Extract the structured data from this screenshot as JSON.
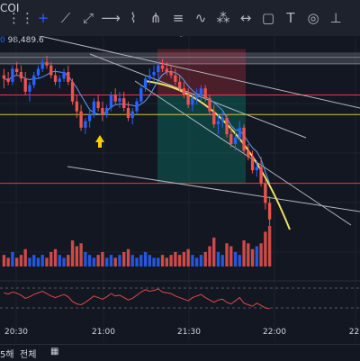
{
  "toolbar": {
    "symbol": "COI",
    "tools": [
      {
        "name": "dots-grid-icon",
        "glyph": "⋮⋮"
      },
      {
        "name": "crosshair-icon",
        "glyph": "+",
        "active": true
      },
      {
        "name": "trend-line-icon",
        "glyph": "⟋"
      },
      {
        "name": "ray-icon",
        "glyph": "⤢"
      },
      {
        "name": "horizontal-ray-icon",
        "glyph": "⟶"
      },
      {
        "name": "path-icon",
        "glyph": "⌇"
      },
      {
        "name": "pitchfork-icon",
        "glyph": "⋔"
      },
      {
        "name": "fib-retracement-icon",
        "glyph": "≡"
      },
      {
        "name": "elliott-wave-icon",
        "glyph": "∿"
      },
      {
        "name": "pattern-icon",
        "glyph": "⁂"
      },
      {
        "name": "measure-icon",
        "glyph": "↔"
      },
      {
        "name": "rectangle-icon",
        "glyph": "▢"
      },
      {
        "name": "text-icon",
        "glyph": "T"
      },
      {
        "name": "note-icon",
        "glyph": "◎"
      },
      {
        "name": "magnet-icon",
        "glyph": "⊥"
      }
    ]
  },
  "legend": {
    "price_suffix": "0",
    "price": "98,489.6"
  },
  "bottom": {
    "interval_suffix": "5해",
    "all_label": "전체",
    "calendar_icon": "calendar-icon"
  },
  "colors": {
    "up": "#2962ff",
    "down": "#ef5350",
    "ma": "#5b9cf0",
    "rsi": "#e04747",
    "accent": "#f0e060",
    "bg": "#131722"
  },
  "chart_data": {
    "type": "candlestick",
    "x_ticks": [
      "20:30",
      "21:00",
      "21:30",
      "22:00",
      "22:"
    ],
    "ohlc": [
      [
        96,
        98,
        92,
        95
      ],
      [
        95,
        97,
        93,
        94
      ],
      [
        94,
        99,
        93,
        98
      ],
      [
        98,
        100,
        96,
        97
      ],
      [
        97,
        99,
        94,
        95
      ],
      [
        95,
        97,
        90,
        91
      ],
      [
        91,
        94,
        88,
        93
      ],
      [
        93,
        97,
        92,
        96
      ],
      [
        96,
        99,
        95,
        98
      ],
      [
        98,
        101,
        97,
        100
      ],
      [
        100,
        102,
        98,
        99
      ],
      [
        99,
        100,
        95,
        96
      ],
      [
        96,
        98,
        93,
        94
      ],
      [
        94,
        96,
        92,
        95
      ],
      [
        95,
        98,
        94,
        97
      ],
      [
        97,
        99,
        93,
        94
      ],
      [
        94,
        95,
        87,
        88
      ],
      [
        88,
        90,
        83,
        85
      ],
      [
        85,
        87,
        79,
        80
      ],
      [
        80,
        83,
        78,
        82
      ],
      [
        82,
        86,
        80,
        84
      ],
      [
        84,
        89,
        83,
        88
      ],
      [
        88,
        90,
        85,
        86
      ],
      [
        86,
        88,
        82,
        84
      ],
      [
        84,
        87,
        83,
        86
      ],
      [
        86,
        91,
        85,
        90
      ],
      [
        90,
        92,
        87,
        88
      ],
      [
        88,
        91,
        86,
        89
      ],
      [
        89,
        91,
        85,
        86
      ],
      [
        86,
        88,
        82,
        83
      ],
      [
        83,
        86,
        81,
        85
      ],
      [
        85,
        89,
        84,
        88
      ],
      [
        88,
        93,
        87,
        92
      ],
      [
        92,
        96,
        91,
        95
      ],
      [
        95,
        98,
        93,
        96
      ],
      [
        96,
        99,
        94,
        97
      ],
      [
        97,
        100,
        95,
        99
      ],
      [
        99,
        101,
        97,
        98
      ],
      [
        98,
        100,
        96,
        97
      ],
      [
        97,
        99,
        95,
        96
      ],
      [
        96,
        98,
        93,
        94
      ],
      [
        94,
        96,
        91,
        92
      ],
      [
        92,
        94,
        89,
        90
      ],
      [
        90,
        92,
        86,
        87
      ],
      [
        87,
        90,
        85,
        89
      ],
      [
        89,
        92,
        87,
        90
      ],
      [
        90,
        93,
        88,
        92
      ],
      [
        92,
        93,
        88,
        89
      ],
      [
        89,
        90,
        84,
        85
      ],
      [
        85,
        87,
        80,
        81
      ],
      [
        81,
        84,
        78,
        82
      ],
      [
        82,
        85,
        80,
        83
      ],
      [
        83,
        84,
        77,
        78
      ],
      [
        78,
        80,
        74,
        75
      ],
      [
        75,
        79,
        73,
        77
      ],
      [
        77,
        82,
        76,
        80
      ],
      [
        80,
        81,
        72,
        73
      ],
      [
        73,
        75,
        70,
        71
      ],
      [
        71,
        73,
        66,
        67
      ],
      [
        67,
        70,
        65,
        68
      ],
      [
        68,
        71,
        62,
        63
      ],
      [
        63,
        64,
        55,
        57
      ],
      [
        57,
        59,
        50,
        52
      ]
    ],
    "volume": [
      4,
      3,
      5,
      3,
      4,
      6,
      3,
      4,
      3,
      4,
      3,
      5,
      6,
      4,
      3,
      4,
      9,
      7,
      8,
      5,
      4,
      3,
      4,
      5,
      3,
      4,
      3,
      4,
      5,
      6,
      4,
      3,
      4,
      5,
      4,
      3,
      3,
      4,
      3,
      4,
      5,
      4,
      5,
      6,
      4,
      3,
      4,
      5,
      7,
      10,
      5,
      4,
      8,
      7,
      5,
      4,
      9,
      8,
      6,
      7,
      8,
      12,
      14
    ],
    "rsi": [
      58,
      55,
      60,
      57,
      52,
      44,
      48,
      54,
      58,
      62,
      56,
      50,
      46,
      50,
      54,
      48,
      36,
      30,
      28,
      34,
      42,
      50,
      46,
      42,
      48,
      56,
      50,
      52,
      46,
      40,
      44,
      52,
      60,
      66,
      62,
      64,
      68,
      60,
      58,
      56,
      50,
      46,
      42,
      38,
      46,
      50,
      54,
      46,
      40,
      34,
      40,
      42,
      34,
      30,
      38,
      46,
      32,
      28,
      24,
      32,
      26,
      20,
      18
    ],
    "h_lines": [
      {
        "price": 101.5,
        "color": "#787b86"
      },
      {
        "price": 99.5,
        "color": "#787b86"
      },
      {
        "price": 90,
        "color": "#f23645"
      },
      {
        "price": 84,
        "color": "#e0c050"
      },
      {
        "price": 63,
        "color": "#f23645"
      }
    ],
    "y_range": [
      42,
      108
    ]
  }
}
